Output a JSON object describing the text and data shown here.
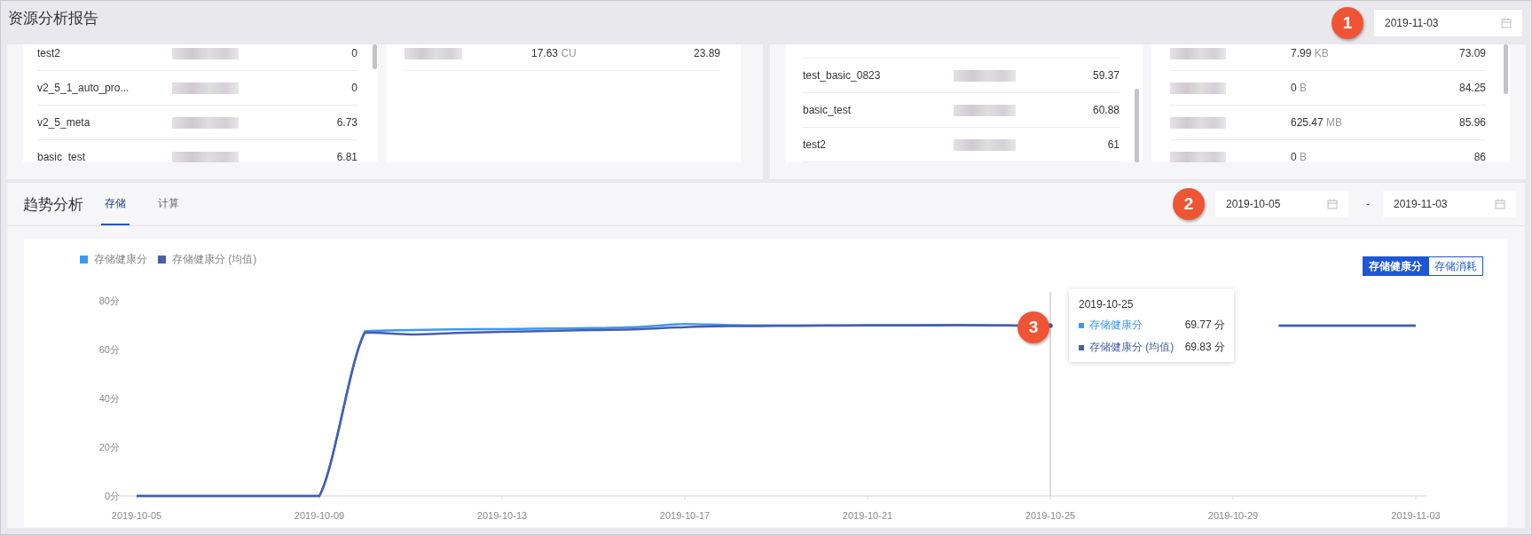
{
  "report": {
    "title": "资源分析报告",
    "callout": "1",
    "date": "2019-11-03"
  },
  "panels": [
    {
      "cards": [
        {
          "kind": "name",
          "rows": [
            {
              "name": "test2",
              "score": "0"
            },
            {
              "name": "v2_5_1_auto_pro...",
              "score": "0"
            },
            {
              "name": "v2_5_meta",
              "score": "6.73"
            },
            {
              "name": "basic_test",
              "score": "6.81"
            }
          ]
        },
        {
          "kind": "usage",
          "rows": [
            {
              "amount": "17.63",
              "unit": "CU",
              "score": "23.89"
            }
          ]
        }
      ]
    },
    {
      "cards": [
        {
          "kind": "name",
          "rows": [
            {
              "name": "test_basic_0823",
              "score": "59.37"
            },
            {
              "name": "basic_test",
              "score": "60.88"
            },
            {
              "name": "test2",
              "score": "61"
            }
          ]
        },
        {
          "kind": "usage",
          "rows": [
            {
              "amount": "7.99",
              "unit": "KB",
              "score": "73.09"
            },
            {
              "amount": "0",
              "unit": "B",
              "score": "84.25"
            },
            {
              "amount": "625.47",
              "unit": "MB",
              "score": "85.96"
            },
            {
              "amount": "0",
              "unit": "B",
              "score": "86"
            }
          ]
        }
      ]
    }
  ],
  "trend": {
    "title": "趋势分析",
    "tabs": [
      {
        "label": "存储",
        "selected": true
      },
      {
        "label": "计算",
        "selected": false
      }
    ],
    "callout": "2",
    "start_date": "2019-10-05",
    "separator": "-",
    "end_date": "2019-11-03",
    "toggle": [
      {
        "label": "存储健康分",
        "selected": true
      },
      {
        "label": "存储消耗",
        "selected": false
      }
    ],
    "chart_data": {
      "type": "line",
      "legend": "top-left",
      "categories": [
        "2019-10-05",
        null,
        null,
        null,
        "2019-10-09",
        null,
        null,
        null,
        "2019-10-13",
        null,
        null,
        null,
        "2019-10-17",
        null,
        null,
        null,
        "2019-10-21",
        null,
        null,
        null,
        "2019-10-25",
        null,
        null,
        null,
        "2019-10-29",
        null,
        null,
        null,
        "2019-11-03"
      ],
      "series": [
        {
          "name": "存储健康分",
          "color": "#3a98fc",
          "values": [
            0,
            0,
            0,
            0,
            0,
            67.5,
            68,
            68.3,
            68.4,
            68.6,
            68.8,
            69.3,
            70.5,
            70,
            69.9,
            69.9,
            70,
            70,
            70.1,
            69.9,
            69.8,
            null,
            null,
            null,
            null,
            69.8,
            69.8,
            69.8,
            69.8
          ]
        },
        {
          "name": "存储健康分 (均值)",
          "color": "#4a5ea8",
          "values": [
            0,
            0,
            0,
            0,
            0,
            67,
            66.2,
            66.8,
            67.3,
            67.6,
            68,
            68.4,
            69.2,
            69.6,
            69.7,
            69.8,
            69.9,
            69.9,
            70,
            69.9,
            69.8,
            null,
            null,
            null,
            null,
            69.8,
            69.8,
            69.8,
            69.8
          ]
        }
      ],
      "ylim": [
        0,
        80
      ],
      "yticks": [
        {
          "value": 0,
          "label": "0分"
        },
        {
          "value": 20,
          "label": "20分"
        },
        {
          "value": 40,
          "label": "40分"
        },
        {
          "value": 60,
          "label": "60分"
        },
        {
          "value": 80,
          "label": "80分"
        }
      ]
    },
    "tooltip": {
      "callout": "3",
      "title": "2019-10-25",
      "rows": [
        {
          "label": "存储健康分",
          "value": "69.77 分"
        },
        {
          "label": "存储健康分 (均值)",
          "value": "69.83 分"
        }
      ]
    }
  }
}
